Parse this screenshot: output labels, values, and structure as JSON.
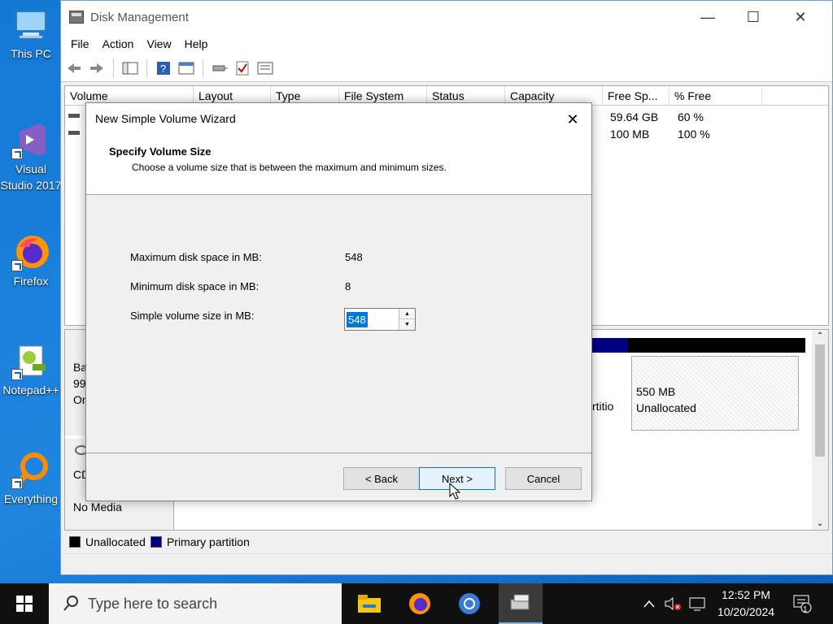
{
  "desktop": {
    "icons": [
      {
        "label": "This PC"
      },
      {
        "label": "Visual Studio 2017"
      },
      {
        "label": "Firefox"
      },
      {
        "label": "Notepad++"
      },
      {
        "label": "Everything"
      }
    ]
  },
  "window": {
    "title": "Disk Management",
    "menu": [
      "File",
      "Action",
      "View",
      "Help"
    ],
    "columns": [
      "Volume",
      "Layout",
      "Type",
      "File System",
      "Status",
      "Capacity",
      "Free Sp...",
      "% Free"
    ],
    "rows": [
      {
        "free": "59.64 GB",
        "pct": "60 %"
      },
      {
        "free": "100 MB",
        "pct": "100 %"
      }
    ],
    "disk_panel": {
      "disk_label_partial": [
        "Ba",
        "99",
        "On"
      ],
      "partition_partial": "rtitio",
      "unalloc_size": "550 MB",
      "unalloc_label": "Unallocated",
      "cd_label_partial": "CD",
      "cd_status": "No Media"
    },
    "legend": [
      {
        "label": "Unallocated",
        "color": "#000000"
      },
      {
        "label": "Primary partition",
        "color": "#000080"
      }
    ]
  },
  "wizard": {
    "title": "New Simple Volume Wizard",
    "heading": "Specify Volume Size",
    "subheading": "Choose a volume size that is between the maximum and minimum sizes.",
    "max_label": "Maximum disk space in MB:",
    "max_value": "548",
    "min_label": "Minimum disk space in MB:",
    "min_value": "8",
    "size_label": "Simple volume size in MB:",
    "size_value": "548",
    "back_label": "< Back",
    "next_label": "Next >",
    "cancel_label": "Cancel"
  },
  "taskbar": {
    "search_placeholder": "Type here to search",
    "time": "12:52 PM",
    "date": "10/20/2024",
    "notification_count": "1"
  }
}
